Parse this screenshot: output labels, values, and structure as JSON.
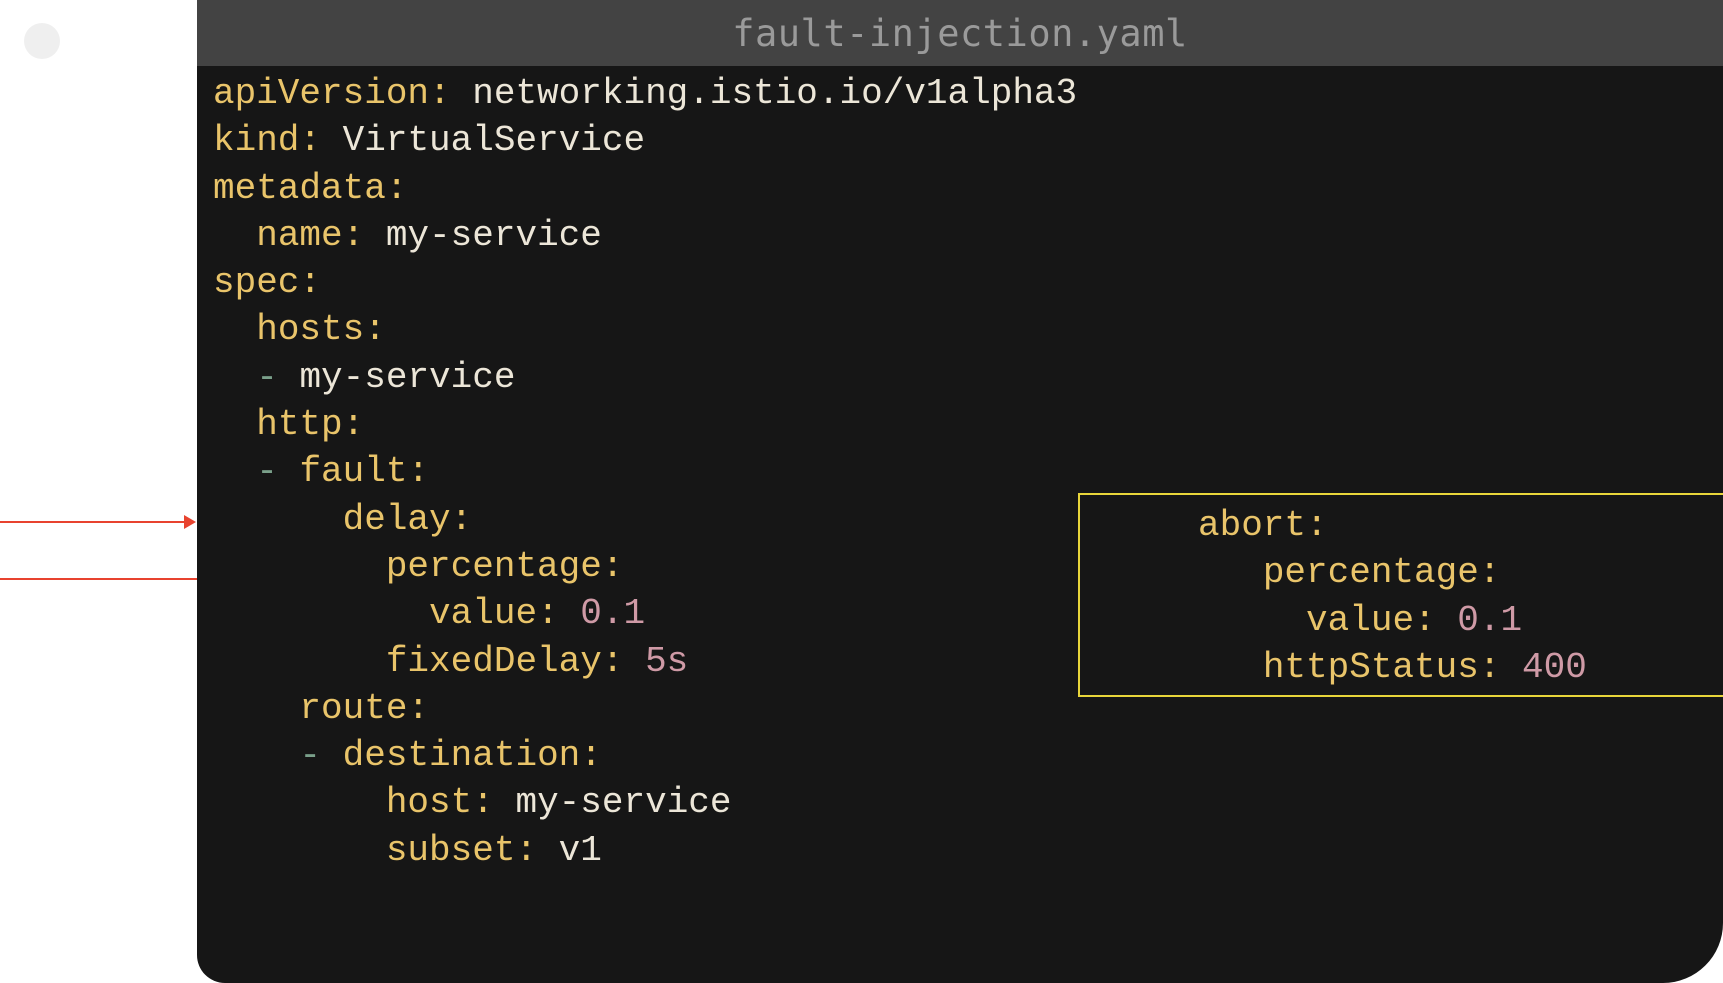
{
  "window": {
    "filename": "fault-injection.yaml"
  },
  "code": {
    "lines": [
      {
        "indent": "",
        "key": "apiVersion:",
        "value": " networking.istio.io/v1alpha3"
      },
      {
        "indent": "",
        "key": "kind:",
        "value": " VirtualService"
      },
      {
        "indent": "",
        "key": "metadata:",
        "value": ""
      },
      {
        "indent": "  ",
        "key": "name:",
        "value": " my-service"
      },
      {
        "indent": "",
        "key": "spec:",
        "value": ""
      },
      {
        "indent": "  ",
        "key": "hosts:",
        "value": ""
      },
      {
        "indent": "  ",
        "dash": "- ",
        "value": "my-service"
      },
      {
        "indent": "  ",
        "key": "http:",
        "value": ""
      },
      {
        "indent": "  ",
        "dash": "- ",
        "key": "fault:",
        "value": ""
      },
      {
        "indent": "      ",
        "key": "delay:",
        "value": ""
      },
      {
        "indent": "        ",
        "key": "percentage:",
        "value": ""
      },
      {
        "indent": "          ",
        "key": "value:",
        "number": " 0.1"
      },
      {
        "indent": "        ",
        "key": "fixedDelay:",
        "number": " 5s"
      },
      {
        "indent": "    ",
        "key": "route:",
        "value": ""
      },
      {
        "indent": "    ",
        "dash": "- ",
        "key": "destination:",
        "value": ""
      },
      {
        "indent": "        ",
        "key": "host:",
        "value": " my-service"
      },
      {
        "indent": "        ",
        "key": "subset:",
        "value": " v1"
      }
    ]
  },
  "abort_box": {
    "lines": [
      {
        "indent": "",
        "key": "abort:",
        "value": ""
      },
      {
        "indent": "   ",
        "key": "percentage:",
        "value": ""
      },
      {
        "indent": "     ",
        "key": "value:",
        "number": " 0.1"
      },
      {
        "indent": "   ",
        "key": "httpStatus:",
        "number": " 400"
      }
    ]
  },
  "colors": {
    "key": "#e9c46a",
    "value": "#ece6d8",
    "number": "#cf9aa6",
    "highlight_border": "#e8d53a",
    "arrow": "#e8432f"
  }
}
